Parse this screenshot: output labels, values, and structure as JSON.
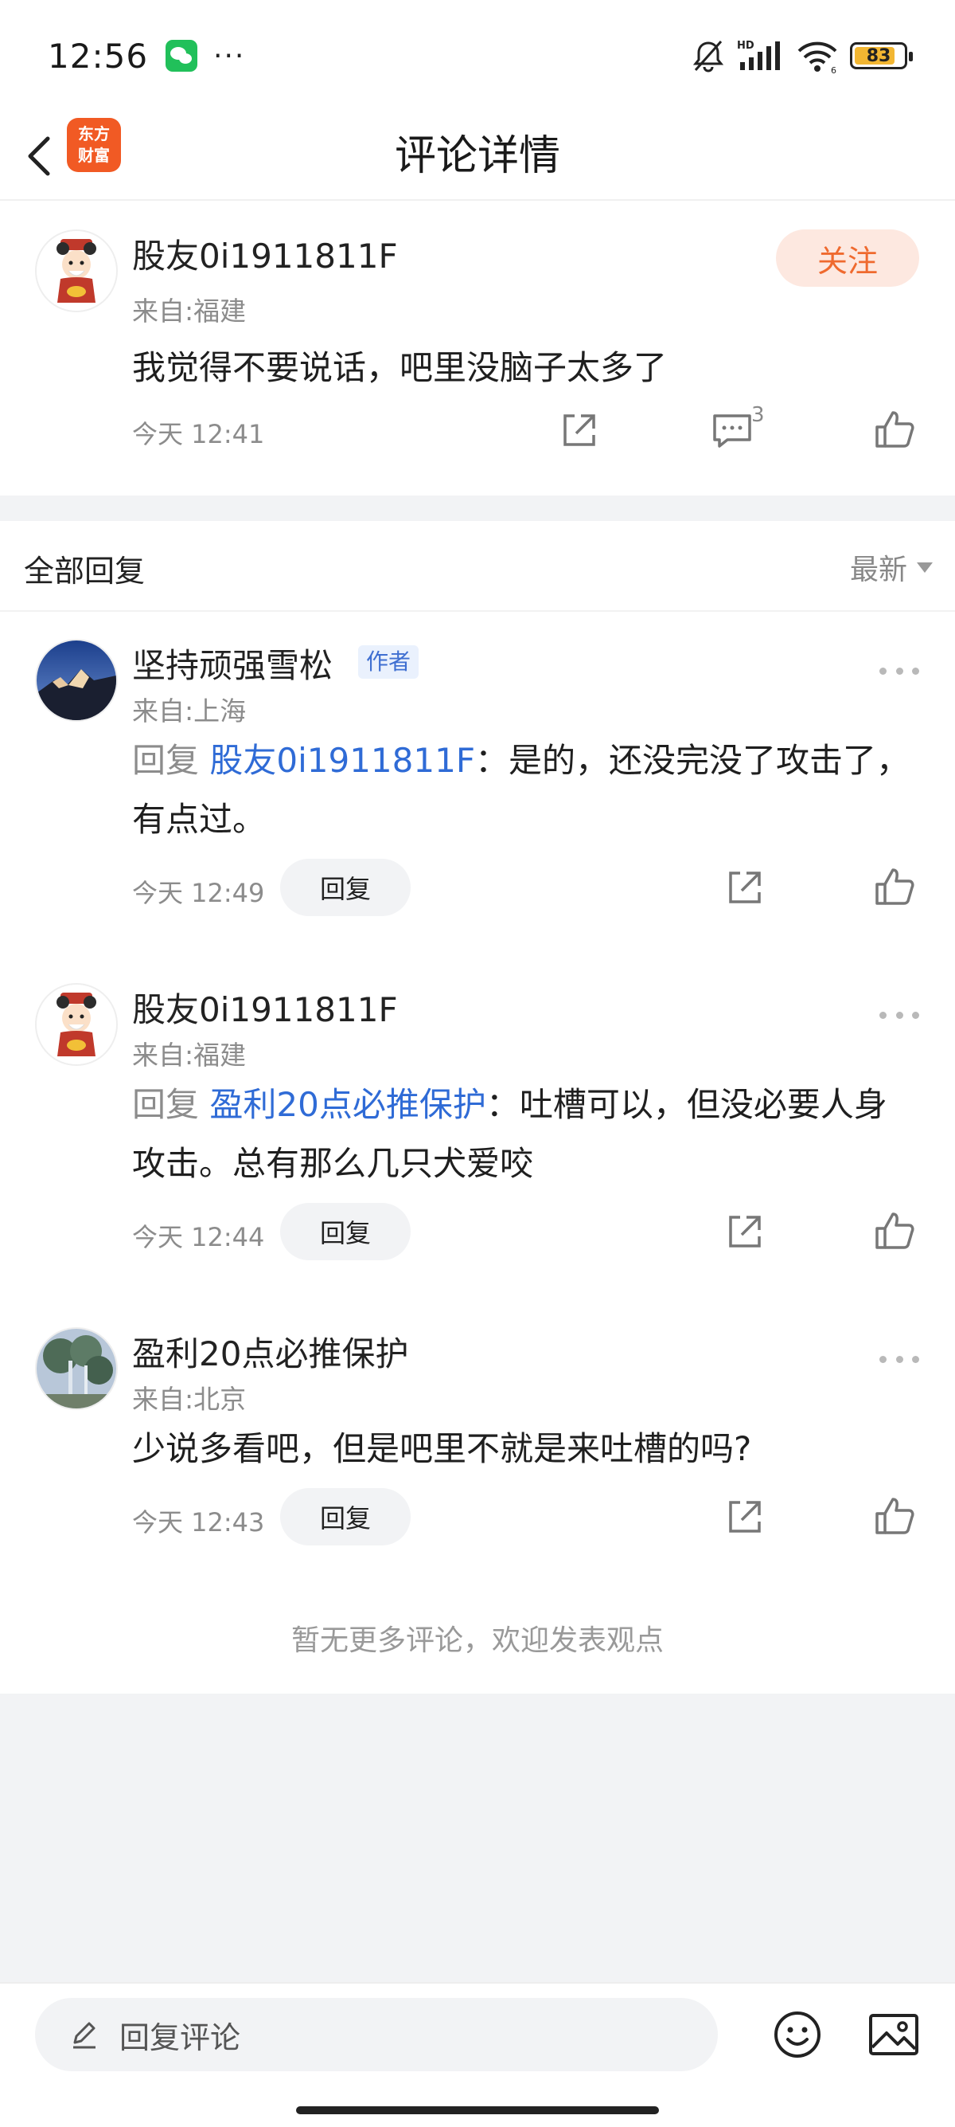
{
  "status_bar": {
    "time": "12:56",
    "battery": "83",
    "battery_level": 0.83,
    "icons": [
      "wechat-icon",
      "mute-icon",
      "hd-signal-icon",
      "wifi-icon",
      "battery-icon"
    ]
  },
  "nav": {
    "title": "评论详情",
    "logo_line1": "东方",
    "logo_line2": "财富",
    "accent": "#f15a24"
  },
  "main_comment": {
    "username": "股友0i1911811F",
    "location": "来自:福建",
    "text": "我觉得不要说话，吧里没脑子太多了",
    "time": "今天 12:41",
    "follow_label": "关注",
    "reply_count": "3"
  },
  "replies_header": {
    "title": "全部回复",
    "sort": "最新"
  },
  "replies": [
    {
      "username": "坚持顽强雪松",
      "tag": "作者",
      "location": "来自:上海",
      "prefix": "回复",
      "mention": "股友0i1911811F",
      "text": "：是的，还没完没了攻击了，有点过。",
      "time": "今天 12:49",
      "reply_label": "回复"
    },
    {
      "username": "股友0i1911811F",
      "location": "来自:福建",
      "prefix": "回复",
      "mention": "盈利20点必推保护",
      "text": "：吐槽可以，但没必要人身攻击。总有那么几只犬爱咬",
      "time": "今天 12:44",
      "reply_label": "回复"
    },
    {
      "username": "盈利20点必推保护",
      "location": "来自:北京",
      "text": "少说多看吧，但是吧里不就是来吐槽的吗?",
      "time": "今天 12:43",
      "reply_label": "回复"
    }
  ],
  "end_note": "暂无更多评论，欢迎发表观点",
  "bottom_bar": {
    "placeholder": "回复评论"
  },
  "colors": {
    "accent": "#ef6a2f",
    "link": "#2f6bd6",
    "muted": "#8c8c8c"
  }
}
